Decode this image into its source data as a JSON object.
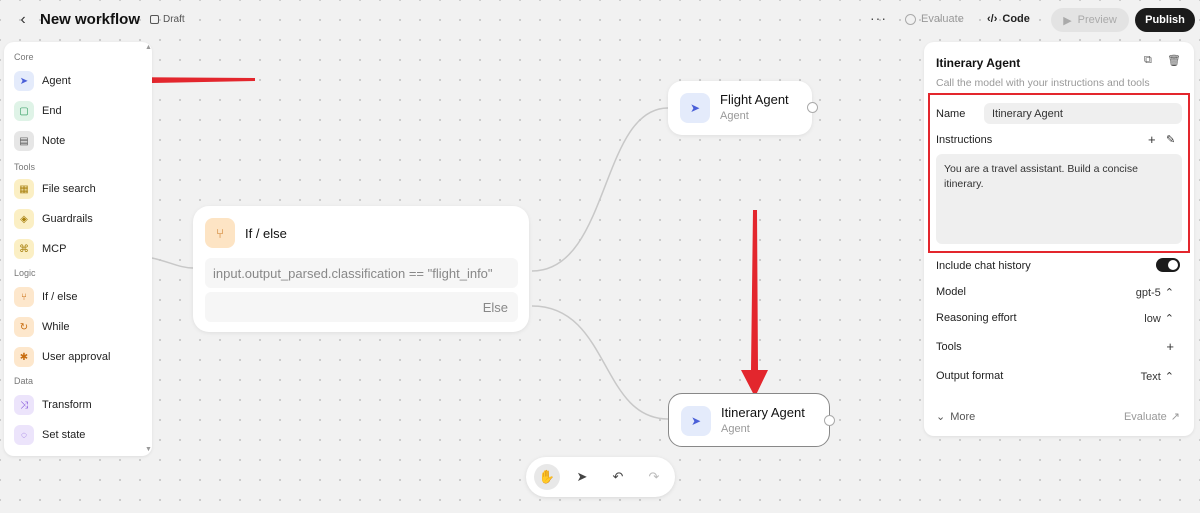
{
  "header": {
    "title": "New workflow",
    "status": "Draft",
    "more": "···",
    "evaluate": "Evaluate",
    "code": "Code",
    "preview": "Preview",
    "publish": "Publish"
  },
  "palette": {
    "sections": [
      {
        "label": "Core",
        "items": [
          {
            "label": "Agent",
            "icon": "agent-icon"
          },
          {
            "label": "End",
            "icon": "end-icon"
          },
          {
            "label": "Note",
            "icon": "note-icon"
          }
        ]
      },
      {
        "label": "Tools",
        "items": [
          {
            "label": "File search",
            "icon": "file-search-icon"
          },
          {
            "label": "Guardrails",
            "icon": "guardrails-icon"
          },
          {
            "label": "MCP",
            "icon": "mcp-icon"
          }
        ]
      },
      {
        "label": "Logic",
        "items": [
          {
            "label": "If / else",
            "icon": "if-else-icon"
          },
          {
            "label": "While",
            "icon": "while-icon"
          },
          {
            "label": "User approval",
            "icon": "user-approval-icon"
          }
        ]
      },
      {
        "label": "Data",
        "items": [
          {
            "label": "Transform",
            "icon": "transform-icon"
          },
          {
            "label": "Set state",
            "icon": "set-state-icon"
          }
        ]
      }
    ]
  },
  "canvas": {
    "ifelse": {
      "title": "If / else",
      "condition": "input.output_parsed.classification == \"flight_info\"",
      "else_label": "Else"
    },
    "flight_agent": {
      "name": "Flight Agent",
      "type": "Agent"
    },
    "itinerary_agent": {
      "name": "Itinerary Agent",
      "type": "Agent"
    }
  },
  "panel": {
    "title": "Itinerary Agent",
    "description": "Call the model with your instructions and tools",
    "name_label": "Name",
    "name_value": "Itinerary Agent",
    "instructions_label": "Instructions",
    "instructions_value": "You are a travel assistant. Build a concise itinerary.",
    "chat_history_label": "Include chat history",
    "chat_history_on": true,
    "model_label": "Model",
    "model_value": "gpt-5",
    "reasoning_label": "Reasoning effort",
    "reasoning_value": "low",
    "tools_label": "Tools",
    "output_label": "Output format",
    "output_value": "Text",
    "more_label": "More",
    "evaluate_label": "Evaluate"
  },
  "colors": {
    "annotation_red": "#e3262d",
    "publish_bg": "#1b1b1b"
  }
}
